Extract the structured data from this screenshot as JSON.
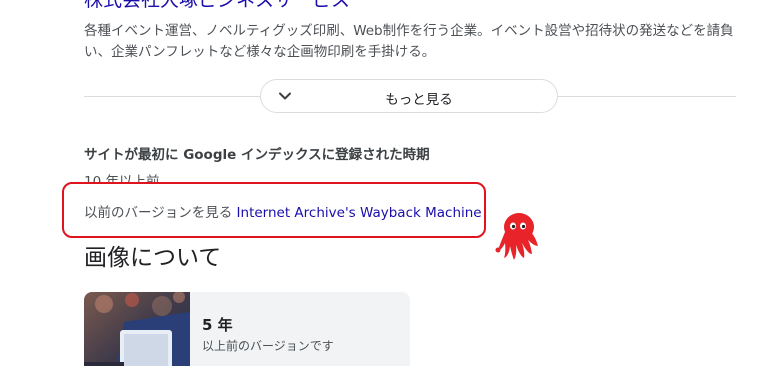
{
  "company": {
    "title": "株式会社大塚ビジネスサービス",
    "description": "各種イベント運営、ノベルティグッズ印刷、Web制作を行う企業。イベント設営や招待状の発送などを請負い、企業パンフレットなど様々な企画物印刷を手掛ける。"
  },
  "more_button": {
    "label": "もっと見る",
    "icon": "chevron-down-icon"
  },
  "index_info": {
    "heading": "サイトが最初に Google インデックスに登録された時期",
    "value": "10 年以上前"
  },
  "wayback": {
    "prefix": "以前のバージョンを見る",
    "link_text": "Internet Archive's Wayback Machine",
    "highlight_color": "#e0141e"
  },
  "mascot": {
    "icon": "octopus-mascot-icon",
    "color": "#e8232a"
  },
  "about_image": {
    "heading": "画像について"
  },
  "image_card": {
    "age": "5 年",
    "caption": "以上前のバージョンです"
  },
  "colors": {
    "link": "#1a0dab",
    "text": "#202124",
    "muted": "#4d5156",
    "card_bg": "#f1f3f4"
  }
}
